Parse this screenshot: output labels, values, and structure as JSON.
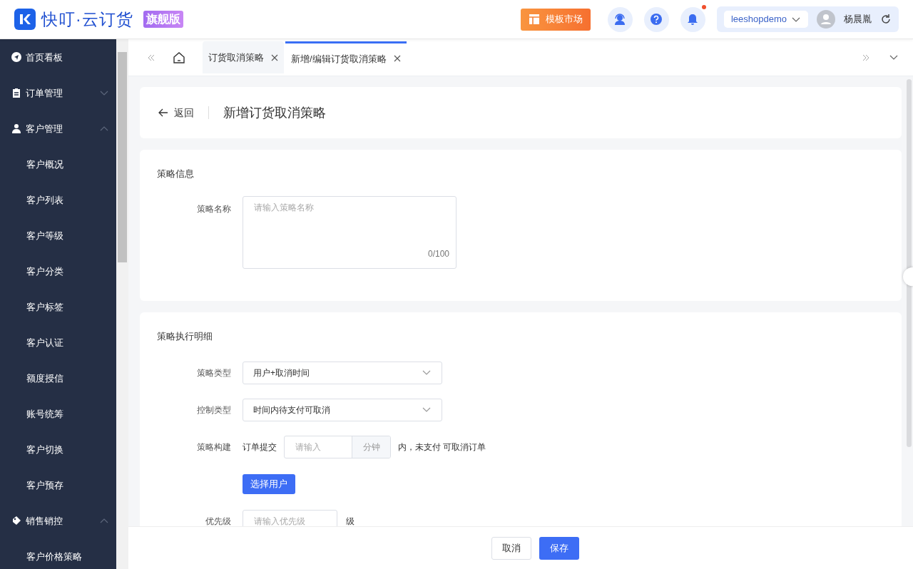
{
  "header": {
    "logo_text": "快叮·云订货",
    "edition_badge": "旗舰版",
    "template_market": "模板市场",
    "notification_dot": true,
    "shop_selector": "leeshopdemo",
    "user_name": "杨晨胤"
  },
  "sidebar": {
    "items": [
      {
        "label": "首页看板",
        "kind": "compass"
      },
      {
        "label": "订单管理",
        "kind": "clipboard",
        "expanded": false
      },
      {
        "label": "客户管理",
        "kind": "person",
        "expanded": true,
        "children": [
          {
            "label": "客户概况"
          },
          {
            "label": "客户列表"
          },
          {
            "label": "客户等级"
          },
          {
            "label": "客户分类"
          },
          {
            "label": "客户标签"
          },
          {
            "label": "客户认证"
          },
          {
            "label": "额度授信"
          },
          {
            "label": "账号统筹"
          },
          {
            "label": "客户切换"
          },
          {
            "label": "客户预存"
          }
        ]
      },
      {
        "label": "销售销控",
        "kind": "tag",
        "expanded": true,
        "children": [
          {
            "label": "客户价格策略"
          }
        ]
      }
    ]
  },
  "tabs": [
    {
      "label": "订货取消策略",
      "selected": false
    },
    {
      "label": "新增/编辑订货取消策略",
      "selected": true
    }
  ],
  "page": {
    "back": "返回",
    "title": "新增订货取消策略"
  },
  "info_section": {
    "title": "策略信息",
    "name_label": "策略名称",
    "name_placeholder": "请输入策略名称",
    "counter": "0/100"
  },
  "detail_section": {
    "title": "策略执行明细",
    "strategy_type": {
      "label": "策略类型",
      "value": "用户+取消时间"
    },
    "control_type": {
      "label": "控制类型",
      "value": "时间内待支付可取消"
    },
    "build": {
      "label": "策略构建",
      "prefix": "订单提交",
      "placeholder": "请输入",
      "unit": "分钟",
      "suffix": "内，未支付 可取消订单"
    },
    "select_user": "选择用户",
    "priority": {
      "label": "优先级",
      "placeholder": "请输入优先级",
      "suffix": "级"
    }
  },
  "footer": {
    "cancel": "取消",
    "save": "保存"
  }
}
